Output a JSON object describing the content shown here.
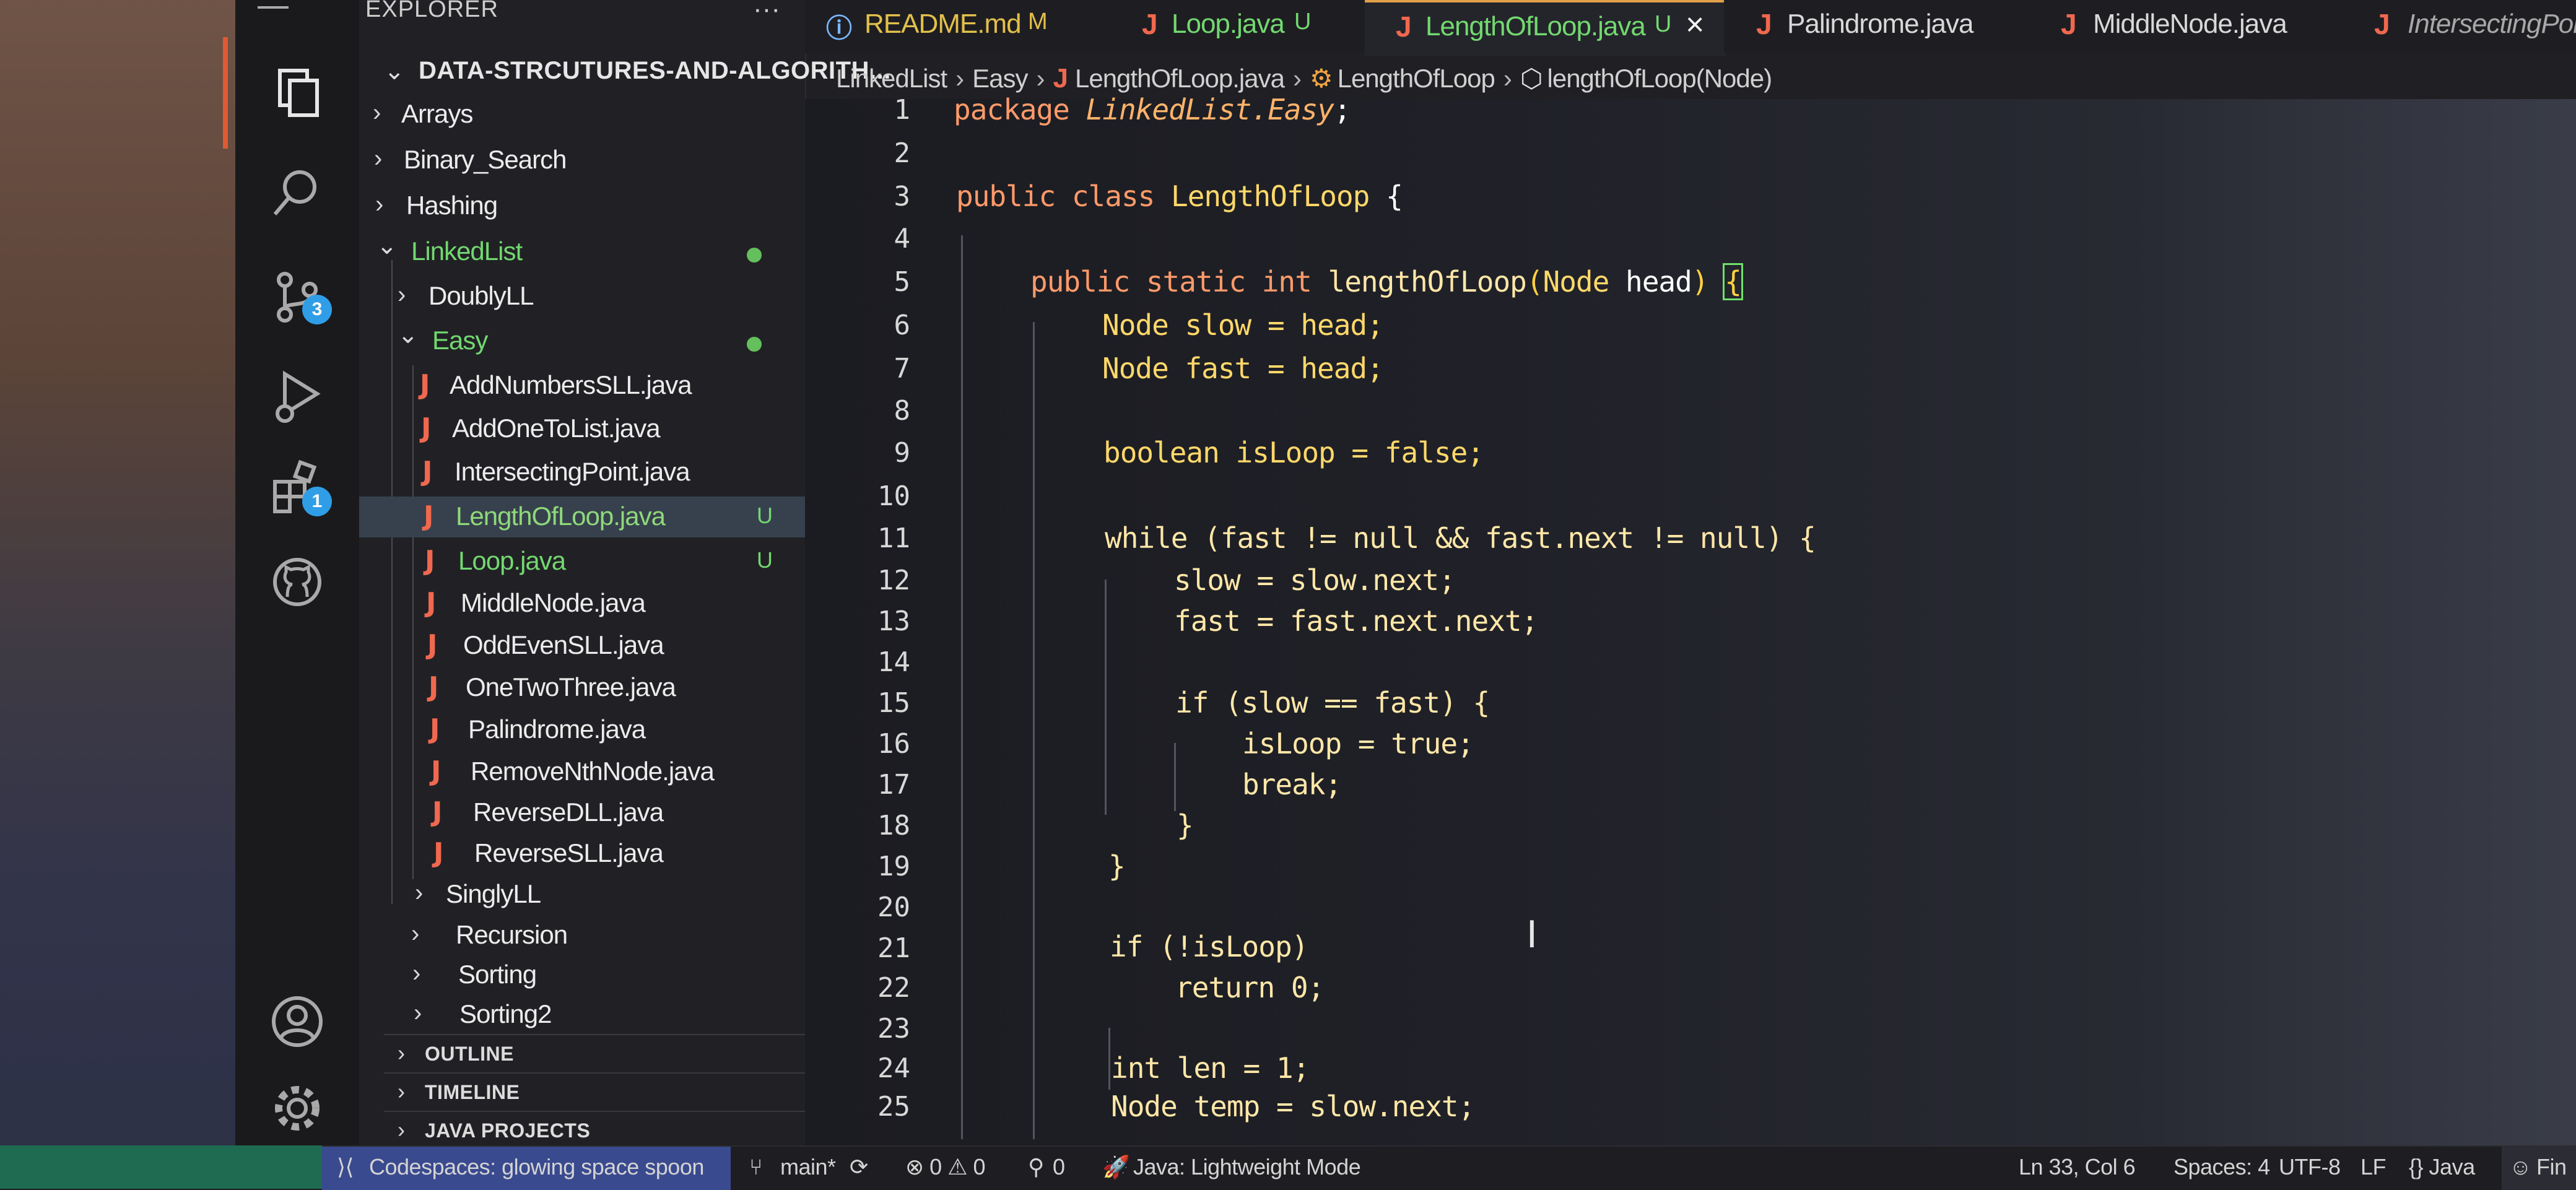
{
  "sidebar": {
    "title": "EXPLORER",
    "more": "···",
    "repo": "DATA-STRCUTURES-AND-ALGORITH...",
    "tree": [
      {
        "label": "Arrays",
        "kind": "folder",
        "open": false
      },
      {
        "label": "Binary_Search",
        "kind": "folder",
        "open": false
      },
      {
        "label": "Hashing",
        "kind": "folder",
        "open": false
      },
      {
        "label": "LinkedList",
        "kind": "folder",
        "open": true,
        "modified": true
      },
      {
        "label": "DoublyLL",
        "kind": "folder",
        "open": false
      },
      {
        "label": "Easy",
        "kind": "folder",
        "open": true,
        "modified": true
      },
      {
        "label": "AddNumbersSLL.java",
        "kind": "file"
      },
      {
        "label": "AddOneToList.java",
        "kind": "file"
      },
      {
        "label": "IntersectingPoint.java",
        "kind": "file"
      },
      {
        "label": "LengthOfLoop.java",
        "kind": "file",
        "status": "U",
        "active": true
      },
      {
        "label": "Loop.java",
        "kind": "file",
        "status": "U"
      },
      {
        "label": "MiddleNode.java",
        "kind": "file"
      },
      {
        "label": "OddEvenSLL.java",
        "kind": "file"
      },
      {
        "label": "OneTwoThree.java",
        "kind": "file"
      },
      {
        "label": "Palindrome.java",
        "kind": "file"
      },
      {
        "label": "RemoveNthNode.java",
        "kind": "file"
      },
      {
        "label": "ReverseDLL.java",
        "kind": "file"
      },
      {
        "label": "ReverseSLL.java",
        "kind": "file"
      },
      {
        "label": "SinglyLL",
        "kind": "folder",
        "open": false
      },
      {
        "label": "Recursion",
        "kind": "folder",
        "open": false
      },
      {
        "label": "Sorting",
        "kind": "folder",
        "open": false
      },
      {
        "label": "Sorting2",
        "kind": "folder",
        "open": false
      }
    ],
    "panels": [
      "OUTLINE",
      "TIMELINE",
      "JAVA PROJECTS"
    ]
  },
  "activity": {
    "icons": [
      "explorer-icon",
      "search-icon",
      "source-control-icon",
      "run-debug-icon",
      "extensions-icon",
      "github-icon",
      "account-icon",
      "settings-gear-icon"
    ],
    "source_control_badge": "3",
    "extensions_badge": "1"
  },
  "tabs": [
    {
      "label": "README.md",
      "mark": "M",
      "icon": "ⓘ"
    },
    {
      "label": "Loop.java",
      "mark": "U",
      "icon": "J"
    },
    {
      "label": "LengthOfLoop.java",
      "mark": "U",
      "icon": "J",
      "active": true
    },
    {
      "label": "Palindrome.java",
      "icon": "J"
    },
    {
      "label": "MiddleNode.java",
      "icon": "J"
    },
    {
      "label": "IntersectingPoi",
      "icon": "J"
    }
  ],
  "breadcrumb": [
    "LinkedList",
    "Easy",
    "LengthOfLoop.java",
    "LengthOfLoop",
    "lengthOfLoop(Node)"
  ],
  "editor": {
    "line_numbers": [
      "1",
      "2",
      "3",
      "4",
      "5",
      "6",
      "7",
      "8",
      "9",
      "10",
      "11",
      "12",
      "13",
      "14",
      "15",
      "16",
      "17",
      "18",
      "19",
      "20",
      "21",
      "22",
      "23",
      "24",
      "25"
    ],
    "code": {
      "l1_kw": "package ",
      "l1_pkg": "LinkedList.Easy",
      "l1_end": ";",
      "l3_kw": "public class ",
      "l3_cl": "LengthOfLoop",
      "l3_end": " {",
      "l5_kw": "public static int ",
      "l5_fn": "lengthOfLoop",
      "l5_open": "(",
      "l5_type": "Node",
      "l5_param": " head",
      "l5_close": ") ",
      "l5_brace": "{",
      "l6": "Node slow = head;",
      "l7": "Node fast = head;",
      "l9": "boolean isLoop = false;",
      "l11": "while (fast != null && fast.next != null) {",
      "l12": "slow = slow.next;",
      "l13": "fast = fast.next.next;",
      "l15": "if (slow == fast) {",
      "l16": "isLoop = true;",
      "l17": "break;",
      "l18": "}",
      "l19": "}",
      "l21": "if (!isLoop)",
      "l22": "return 0;",
      "l24": "int len = 1;",
      "l25": "Node temp = slow.next;"
    }
  },
  "status": {
    "codespace": "Codespaces: glowing space spoon",
    "branch": "main*",
    "problems": "⊗ 0 ⚠ 0",
    "ports": "0",
    "java_mode": "Java: Lightweight Mode",
    "position": "Ln 33, Col 6",
    "spaces": "Spaces: 4",
    "encoding": "UTF-8",
    "eol": "LF",
    "language": "{} Java",
    "feedback": "Fin"
  },
  "colors": {
    "accent_orange": "#e05a33",
    "git_green": "#73d870",
    "badge_blue": "#2f9ee7",
    "java_icon": "#f0684f"
  }
}
